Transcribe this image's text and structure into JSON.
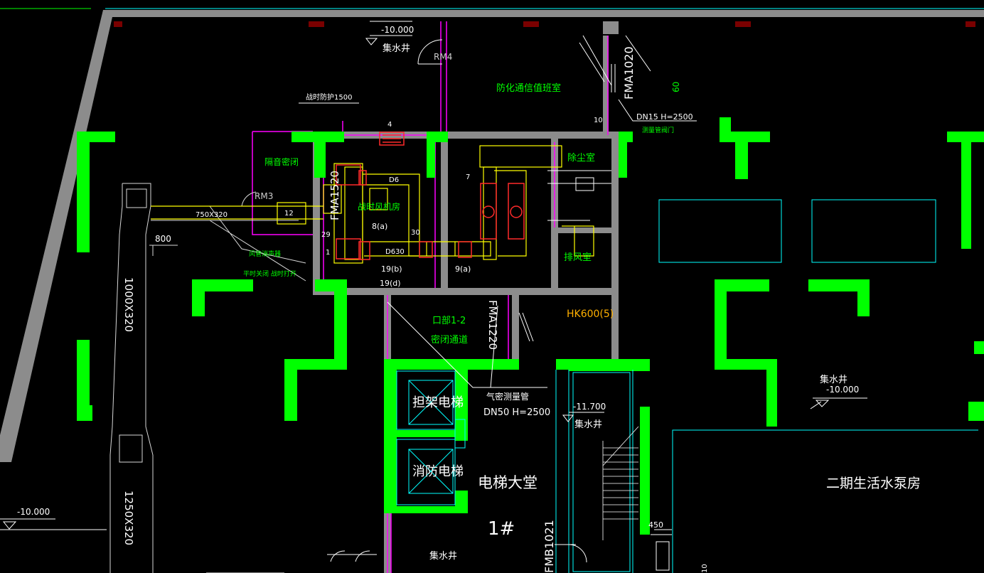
{
  "labels": {
    "elev_top": "-10.000",
    "sump_top": "集水井",
    "rm4": "RM4",
    "civil_room": "防化通信值班室",
    "fma1020": "FMA1020",
    "elev_dim_top": "60",
    "dn15": "DN15 H=2500",
    "dn15_note": "测量管阀门",
    "num_10": "10",
    "duct_note": "战时防护1500",
    "num_4": "4",
    "valve_room": "隔音密闭",
    "rm3": "RM3",
    "fma1520": "FMA1520",
    "fan_room": "战时风机房",
    "dust_room": "除尘室",
    "exhaust_room": "排风室",
    "duct_750": "750X320",
    "num_12": "12",
    "dim_800": "800",
    "note_a": "风管消声器",
    "note_b": "平时关闭 战时打开",
    "num_29": "29",
    "num_8a": "8(a)",
    "num_30": "30",
    "num_1": "1",
    "d630": "D630",
    "d6": "D6",
    "num_7": "7",
    "num_9b": "19(b)",
    "num_9d": "19(d)",
    "num_9a": "9(a)",
    "duct_1000": "1000X320",
    "duct_1250": "1250X320",
    "hk600": "HK600(5)",
    "corridor_a": "口部1-2",
    "corridor_b": "密闭通道",
    "fma1220": "FMA1220",
    "gas_pipe": "气密测量管",
    "dn50": "DN50 H=2500",
    "stretcher_lift": "担架电梯",
    "fire_lift": "消防电梯",
    "lift_hall": "电梯大堂",
    "num_1hash": "1#",
    "sump_bottom": "集水井",
    "fmb1021": "FMB1021",
    "elev_1170": "-11.700",
    "sump_stair": "集水井",
    "sump_right": "集水井",
    "elev_right": "-10.000",
    "pump_room": "二期生活水泵房",
    "elev_left": "-10.000",
    "dim_450": "450",
    "dim_10": "10"
  },
  "colors": {
    "background": "#000000",
    "green_wall": "#00ff00",
    "gray_wall": "#8c8c8c",
    "magenta": "#ff00ff",
    "yellow": "#ffff00",
    "cyan": "#00ffff",
    "red": "#ff2a2a",
    "white": "#ffffff",
    "orange": "#ffb000"
  }
}
